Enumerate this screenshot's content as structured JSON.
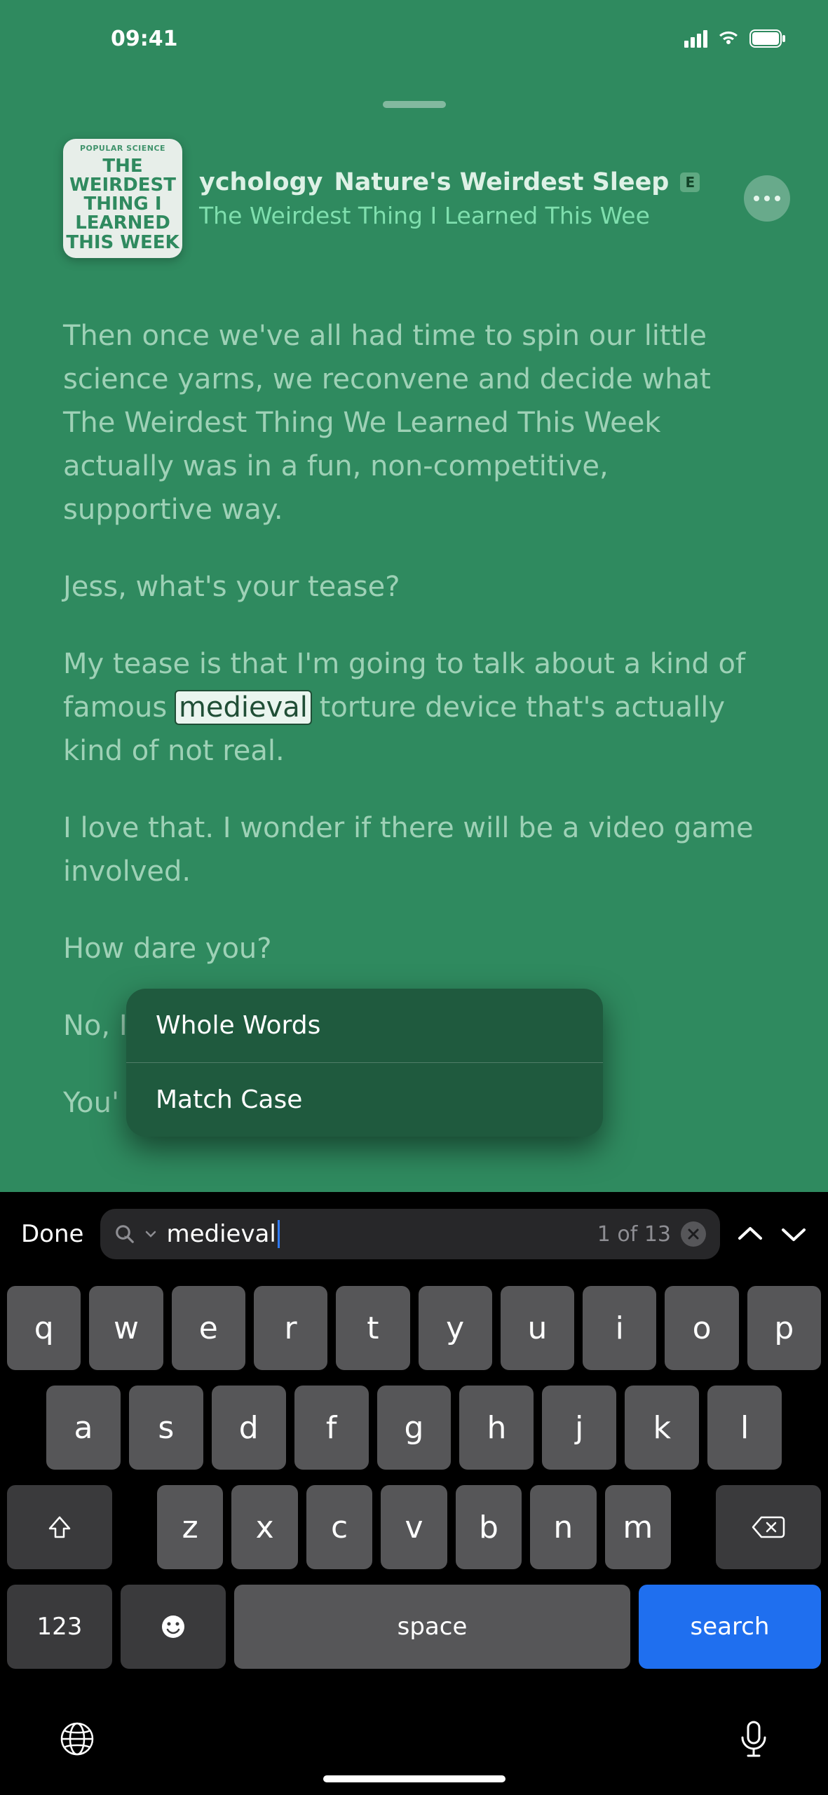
{
  "status": {
    "time": "09:41"
  },
  "artwork": {
    "popular": "POPULAR SCIENCE",
    "l1": "THE",
    "l2": "WEIRDEST",
    "l3": "THING I",
    "l4": "LEARNED",
    "l5": "THIS WEEK"
  },
  "header": {
    "title_left": "ychology",
    "title_right": "Nature's Weirdest Sleep",
    "explicit": "E",
    "subtitle": "The Weirdest Thing I Learned This Wee"
  },
  "transcript": {
    "p1": "Then once we've all had time to spin our little science yarns, we reconvene and decide what The Weirdest Thing We Learned This Week actually was in a fun, non-competitive, supportive way.",
    "p2": "Jess, what's your tease?",
    "p3_a": "My tease is that I'm going to talk about a kind of famous ",
    "p3_hl": "medieval",
    "p3_b": " torture device that's actually kind of not real.",
    "p4": "I love that. I wonder if there will be a video game involved.",
    "p5": "How dare you?",
    "p6": "No, I",
    "p7": "You'"
  },
  "popover": {
    "whole": "Whole Words",
    "matchcase": "Match Case"
  },
  "search": {
    "done": "Done",
    "query": "medieval",
    "count": "1 of 13"
  },
  "keyboard": {
    "r1": [
      "q",
      "w",
      "e",
      "r",
      "t",
      "y",
      "u",
      "i",
      "o",
      "p"
    ],
    "r2": [
      "a",
      "s",
      "d",
      "f",
      "g",
      "h",
      "j",
      "k",
      "l"
    ],
    "r3": [
      "z",
      "x",
      "c",
      "v",
      "b",
      "n",
      "m"
    ],
    "numbers": "123",
    "space": "space",
    "search": "search"
  }
}
